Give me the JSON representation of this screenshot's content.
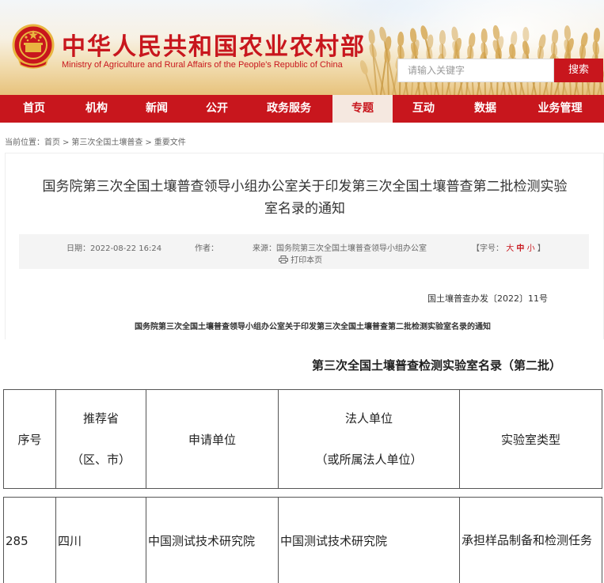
{
  "site": {
    "title_cn": "中华人民共和国农业农村部",
    "title_en": "Ministry of Agriculture and Rural Affairs of the People's Republic of China",
    "search_placeholder": "请输入关键字",
    "search_button": "搜索"
  },
  "nav": {
    "items": [
      "首页",
      "机构",
      "新闻",
      "公开",
      "政务服务",
      "专题",
      "互动",
      "数据",
      "业务管理"
    ],
    "active": "专题"
  },
  "breadcrumb": {
    "prefix": "当前位置：",
    "items": [
      "首页",
      "第三次全国土壤普查",
      "重要文件"
    ],
    "separator": ">"
  },
  "article": {
    "title_line1": "国务院第三次全国土壤普查领导小组办公室关于印发第三次全国土壤普查第二批检测实验",
    "title_line2": "室名录的通知",
    "date": "日期：2022-08-22 16:24",
    "author": "作者：",
    "source": "来源：国务院第三次全国土壤普查领导小组办公室",
    "font_size_label": "【字号：",
    "font_sizes": [
      "大",
      "中",
      "小"
    ],
    "font_size_end": "】",
    "print": "打印本页",
    "doc_number": "国土壤普查办发〔2022〕11号",
    "sub_heading": "国务院第三次全国土壤普查领导小组办公室关于印发第三次全国土壤普查第二批检测实验室名录的通知"
  },
  "table": {
    "caption": "第三次全国土壤普查检测实验室名录（第二批）",
    "headers": {
      "index": "序号",
      "province_l1": "推荐省",
      "province_l2": "（区、市）",
      "applicant": "申请单位",
      "legal_l1": "法人单位",
      "legal_l2": "（或所属法人单位）",
      "lab_type": "实验室类型"
    },
    "rows": [
      {
        "index": "285",
        "province": "四川",
        "applicant": "中国测试技术研究院",
        "legal": "中国测试技术研究院",
        "lab_type": "承担样品制备和检测任务"
      }
    ]
  }
}
